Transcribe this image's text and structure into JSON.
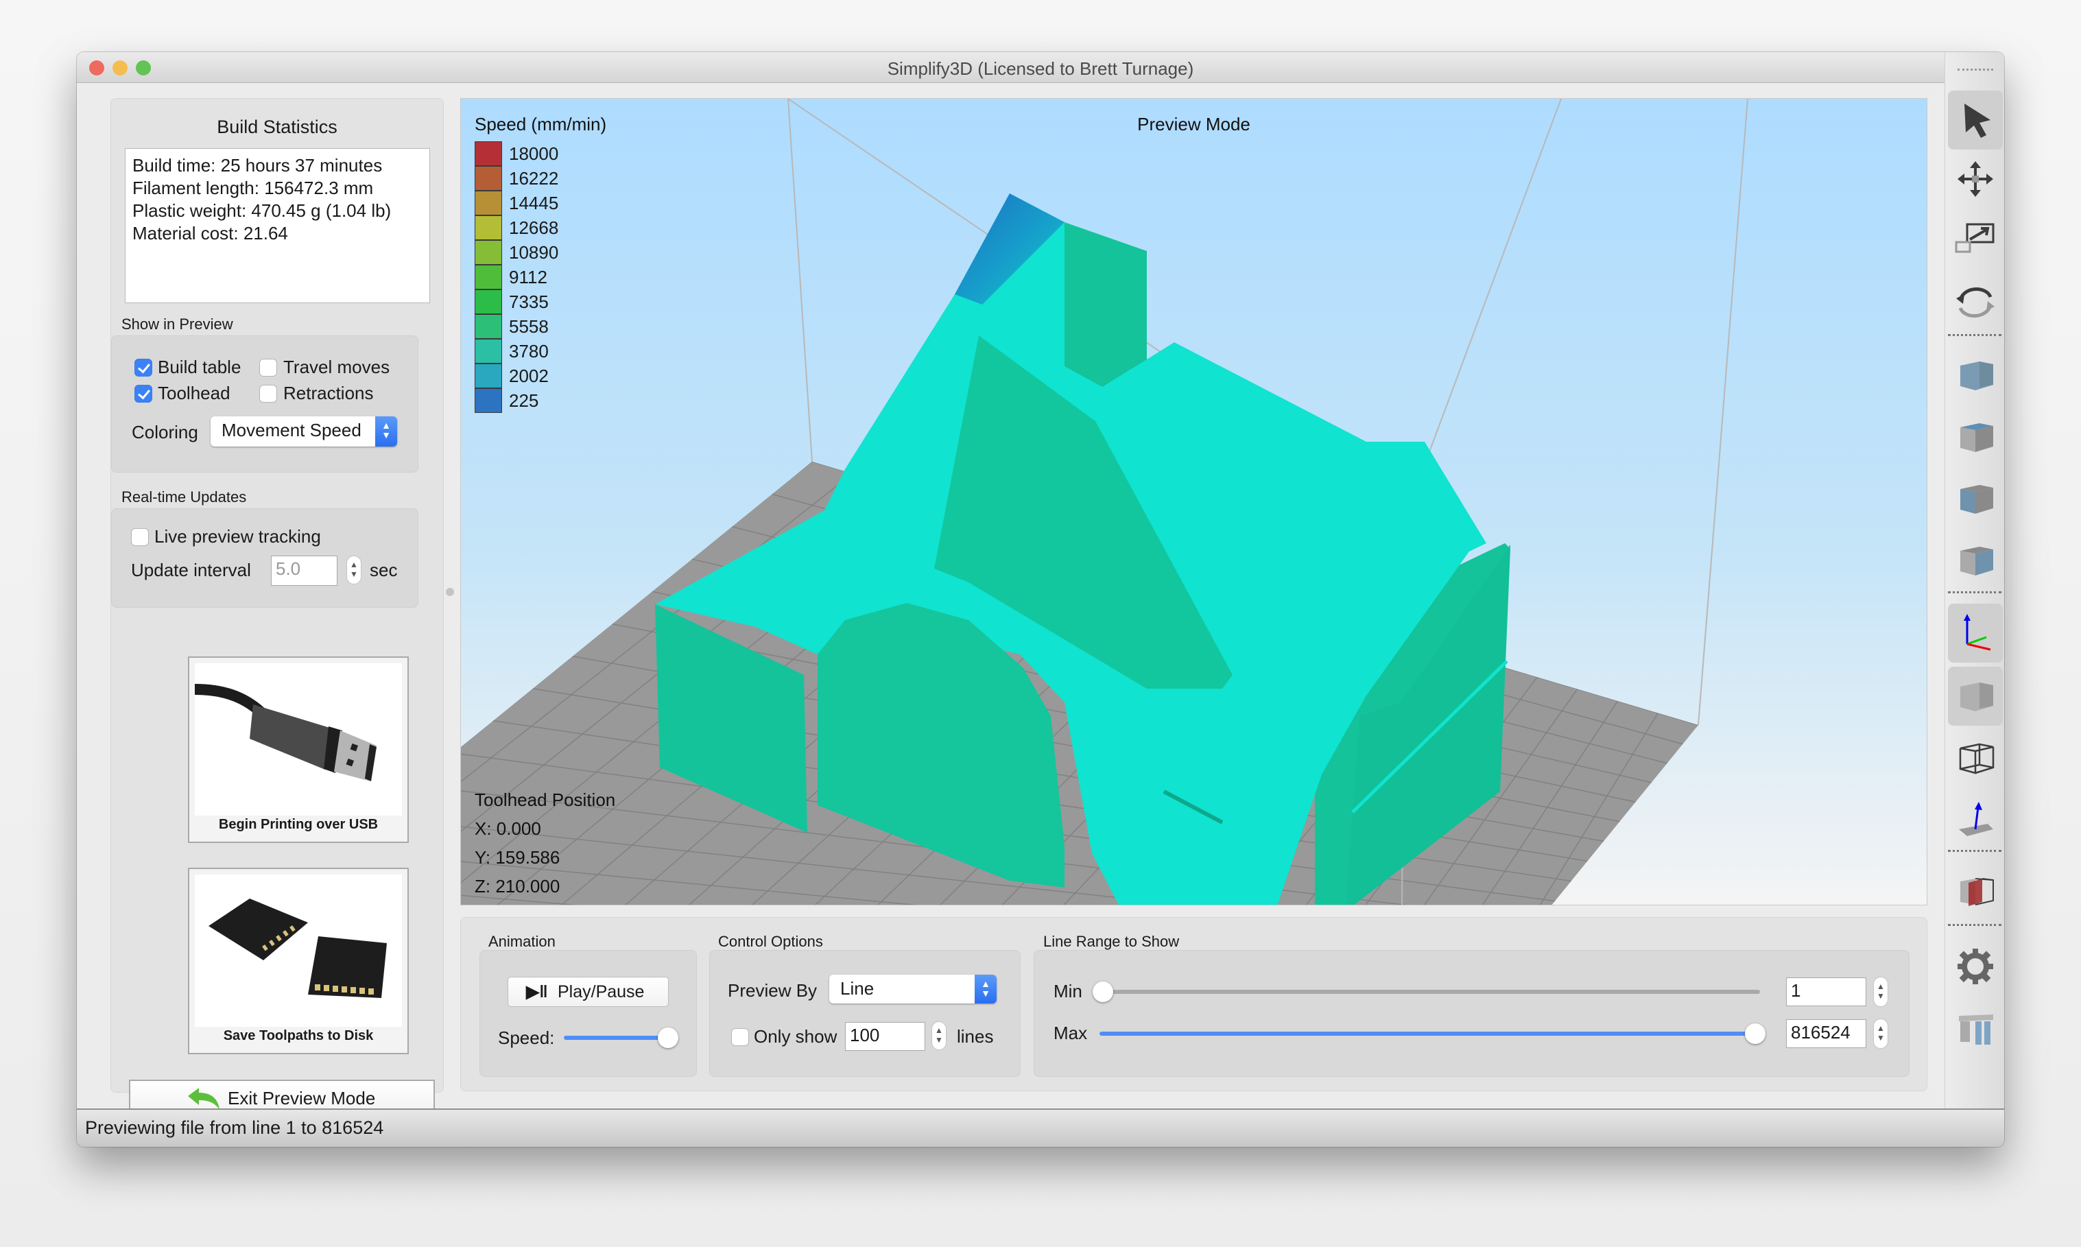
{
  "window": {
    "title": "Simplify3D (Licensed to Brett Turnage)",
    "controls": [
      {
        "name": "close",
        "color": "#ee6a5e"
      },
      {
        "name": "minimize",
        "color": "#f5bd4f"
      },
      {
        "name": "zoom",
        "color": "#61c454"
      }
    ]
  },
  "build_statistics": {
    "title": "Build Statistics",
    "lines": [
      "Build time: 25 hours 37 minutes",
      "Filament length: 156472.3 mm",
      "Plastic weight: 470.45 g (1.04 lb)",
      "Material cost: 21.64"
    ]
  },
  "show_in_preview": {
    "label": "Show in Preview",
    "checkboxes": [
      {
        "label": "Build table",
        "checked": true
      },
      {
        "label": "Travel moves",
        "checked": false
      },
      {
        "label": "Toolhead",
        "checked": true
      },
      {
        "label": "Retractions",
        "checked": false
      }
    ],
    "coloring_label": "Coloring",
    "coloring_value": "Movement Speed"
  },
  "realtime_updates": {
    "label": "Real-time Updates",
    "live_tracking_label": "Live preview tracking",
    "live_tracking_checked": false,
    "update_interval_label": "Update interval",
    "update_interval_value": "5.0",
    "update_interval_unit": "sec"
  },
  "actions": {
    "usb_caption": "Begin Printing over USB",
    "disk_caption": "Save Toolpaths to Disk",
    "exit_label": "Exit Preview Mode"
  },
  "viewport": {
    "mode_label": "Preview Mode",
    "legend_title": "Speed (mm/min)",
    "legend": [
      {
        "value": "18000",
        "color": "#b53036"
      },
      {
        "value": "16222",
        "color": "#b55e35"
      },
      {
        "value": "14445",
        "color": "#b68f37"
      },
      {
        "value": "12668",
        "color": "#b4bd36"
      },
      {
        "value": "10890",
        "color": "#86bd37"
      },
      {
        "value": "9112",
        "color": "#4fbd3a"
      },
      {
        "value": "7335",
        "color": "#2bbd48"
      },
      {
        "value": "5558",
        "color": "#2bbf78"
      },
      {
        "value": "3780",
        "color": "#2bbfa5"
      },
      {
        "value": "2002",
        "color": "#2aa8c0"
      },
      {
        "value": "225",
        "color": "#2c74c2"
      }
    ],
    "toolhead_title": "Toolhead Position",
    "toolhead": {
      "x": "X: 0.000",
      "y": "Y: 159.586",
      "z": "Z: 210.000"
    },
    "model_colors": {
      "top": "#10e3d0",
      "side": "#14c39a",
      "dark": "#0ea88a",
      "tip": "#1d6fc4",
      "bed": "#999999"
    }
  },
  "animation": {
    "label": "Animation",
    "play_pause_label": "Play/Pause",
    "speed_label": "Speed:",
    "speed_fraction": 1.0
  },
  "control_options": {
    "label": "Control Options",
    "preview_by_label": "Preview By",
    "preview_by_value": "Line",
    "only_show_label": "Only show",
    "only_show_checked": false,
    "only_show_value": "100",
    "only_show_unit": "lines"
  },
  "line_range": {
    "label": "Line Range to Show",
    "min_label": "Min",
    "min_value": "1",
    "max_label": "Max",
    "max_value": "816524",
    "min_fraction": 0.0,
    "max_fraction": 1.0
  },
  "toolbar": {
    "tools": [
      {
        "icon": "select-arrow-icon",
        "active": true
      },
      {
        "icon": "move-icon",
        "active": false
      },
      {
        "icon": "scale-icon",
        "active": false
      },
      {
        "icon": "rotate-icon",
        "active": false
      },
      {
        "icon": "view-isometric-icon",
        "active": false
      },
      {
        "icon": "view-top-icon",
        "active": false
      },
      {
        "icon": "view-front-icon",
        "active": false
      },
      {
        "icon": "view-side-icon",
        "active": false
      },
      {
        "icon": "axes-icon",
        "active": true
      },
      {
        "icon": "solid-view-icon",
        "active": true
      },
      {
        "icon": "wireframe-view-icon",
        "active": false
      },
      {
        "icon": "normals-icon",
        "active": false
      },
      {
        "icon": "cross-section-icon",
        "active": false
      },
      {
        "icon": "settings-gear-icon",
        "active": false
      },
      {
        "icon": "supports-icon",
        "active": false
      }
    ]
  },
  "status_bar": {
    "text": "Previewing file from line 1 to 816524"
  }
}
